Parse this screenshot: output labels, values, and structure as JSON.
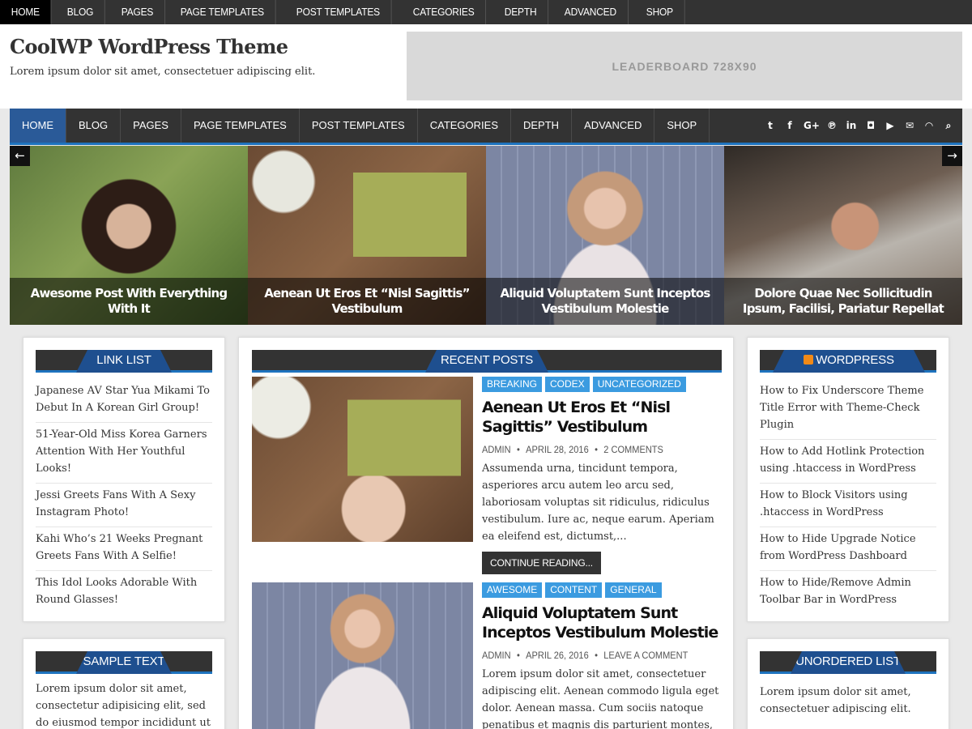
{
  "top_nav": [
    "HOME",
    "BLOG",
    "PAGES",
    "PAGE TEMPLATES",
    "POST TEMPLATES",
    "CATEGORIES",
    "DEPTH",
    "ADVANCED",
    "SHOP"
  ],
  "header": {
    "title": "CoolWP WordPress Theme",
    "description": "Lorem ipsum dolor sit amet, consectetuer adipiscing elit.",
    "ad_label": "LEADERBOARD 728X90"
  },
  "main_nav": [
    "HOME",
    "BLOG",
    "PAGES",
    "PAGE TEMPLATES",
    "POST TEMPLATES",
    "CATEGORIES",
    "DEPTH",
    "ADVANCED",
    "SHOP"
  ],
  "social_icons": [
    "twitter-icon",
    "facebook-icon",
    "google-plus-icon",
    "pinterest-icon",
    "linkedin-icon",
    "instagram-icon",
    "youtube-icon",
    "email-icon",
    "rss-icon",
    "search-icon"
  ],
  "slider": {
    "prev": "←",
    "next": "→",
    "slides": [
      {
        "title": "Awesome Post With Everything With It"
      },
      {
        "title": "Aenean Ut Eros Et “Nisl Sagittis” Vestibulum"
      },
      {
        "title": "Aliquid Voluptatem Sunt Inceptos Vestibulum Molestie"
      },
      {
        "title": "Dolore Quae Nec Sollicitudin Ipsum, Facilisi, Pariatur Repellat"
      }
    ]
  },
  "left_sidebar": {
    "link_list": {
      "title": "LINK LIST",
      "items": [
        "Japanese AV Star Yua Mikami To Debut In A Korean Girl Group!",
        "51-Year-Old Miss Korea Garners Attention With Her Youthful Looks!",
        "Jessi Greets Fans With A Sexy Instagram Photo!",
        "Kahi Who’s 21 Weeks Pregnant Greets Fans With A Selfie!",
        "This Idol Looks Adorable With Round Glasses!"
      ]
    },
    "sample_text": {
      "title": "SAMPLE TEXT",
      "text": "Lorem ipsum dolor sit amet, consectetur adipisicing elit, sed do eiusmod tempor incididunt ut"
    }
  },
  "main": {
    "section_title": "RECENT POSTS",
    "posts": [
      {
        "categories": [
          "BREAKING",
          "CODEX",
          "UNCATEGORIZED"
        ],
        "title": "Aenean Ut Eros Et “Nisl Sagittis” Vestibulum",
        "author": "ADMIN",
        "date": "APRIL 28, 2016",
        "comments": "2 COMMENTS",
        "excerpt": "Assumenda urna, tincidunt tempora, asperiores arcu autem leo arcu sed, laboriosam voluptas sit ridiculus, ridiculus vestibulum. Iure ac, neque earum. Aperiam ea eleifend est, dictumst,...",
        "read_more": "CONTINUE READING..."
      },
      {
        "categories": [
          "AWESOME",
          "CONTENT",
          "GENERAL"
        ],
        "title": "Aliquid Voluptatem Sunt Inceptos Vestibulum Molestie",
        "author": "ADMIN",
        "date": "APRIL 26, 2016",
        "comments": "LEAVE A COMMENT",
        "excerpt": "Lorem ipsum dolor sit amet, consectetuer adipiscing elit. Aenean commodo ligula eget dolor. Aenean massa. Cum sociis natoque penatibus et magnis dis parturient montes,"
      }
    ]
  },
  "right_sidebar": {
    "tutorials": {
      "title": "WORDPRESS TUTORIALS",
      "items": [
        "How to Fix Underscore Theme Title Error with Theme-Check Plugin",
        "How to Add Hotlink Protection using .htaccess in WordPress",
        "How to Block Visitors using .htaccess in WordPress",
        "How to Hide Upgrade Notice from WordPress Dashboard",
        "How to Hide/Remove Admin Toolbar Bar in WordPress"
      ]
    },
    "unordered_list": {
      "title": "UNORDERED LIST",
      "items": [
        "Lorem ipsum dolor sit amet, consectetuer adipiscing elit."
      ]
    }
  },
  "colors": {
    "accent": "#1e73be",
    "tab": "#1e4f8f",
    "category_badge": "#3b9be0",
    "nav_bg": "#333333"
  }
}
